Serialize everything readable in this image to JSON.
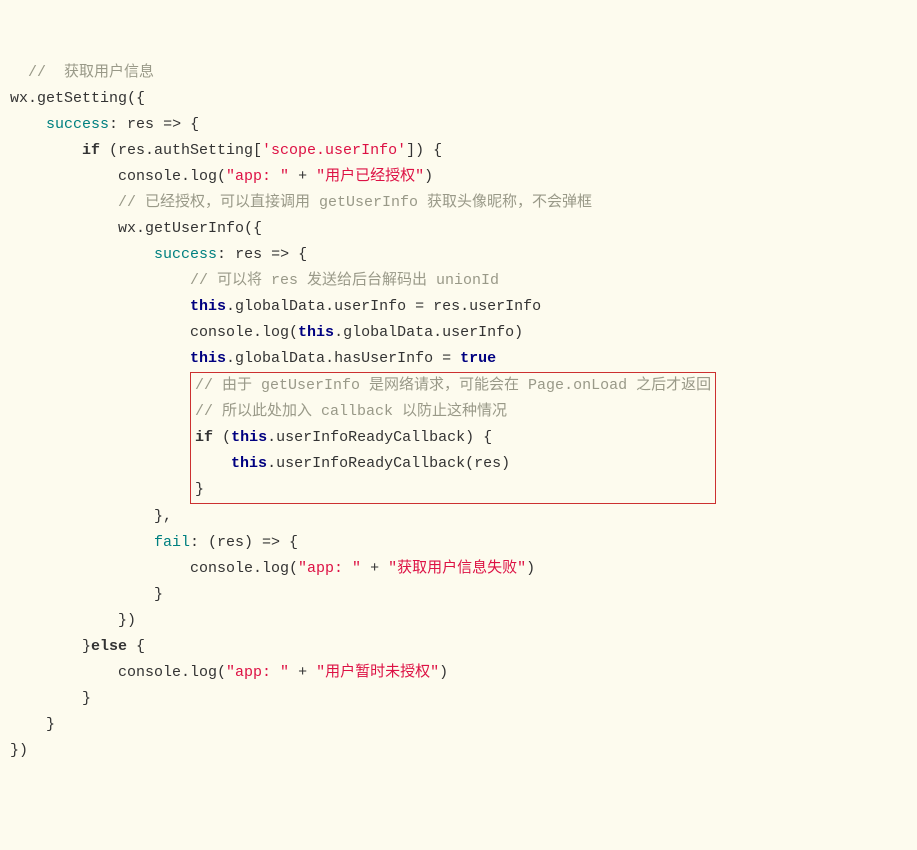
{
  "code": {
    "l01": "  //  获取用户信息",
    "l02a": "wx",
    "l02b": ".getSetting({",
    "l03a": "    success",
    "l03b": ": ",
    "l03c": "res",
    "l03d": " => {",
    "l04a": "        if",
    "l04b": " (res.authSetting[",
    "l04c": "'scope.userInfo'",
    "l04d": "]) {",
    "l05a": "            console.log(",
    "l05b": "\"app: \"",
    "l05c": " + ",
    "l05d": "\"用户已经授权\"",
    "l05e": ")",
    "l06": "            // 已经授权，可以直接调用 getUserInfo 获取头像昵称，不会弹框",
    "l07a": "            wx",
    "l07b": ".getUserInfo({",
    "l08a": "                success",
    "l08b": ": ",
    "l08c": "res",
    "l08d": " => {",
    "l09": "                    // 可以将 res 发送给后台解码出 unionId",
    "l10a": "                    ",
    "l10b": "this",
    "l10c": ".globalData.userInfo = res.userInfo",
    "l11a": "                    console.log(",
    "l11b": "this",
    "l11c": ".globalData.userInfo)",
    "l12a": "                    ",
    "l12b": "this",
    "l12c": ".globalData.hasUserInfo = ",
    "l12d": "true",
    "pad": "                    ",
    "h01": "// 由于 getUserInfo 是网络请求，可能会在 Page.onLoad 之后才返回",
    "h02": "// 所以此处加入 callback 以防止这种情况",
    "h03a": "if",
    "h03b": " (",
    "h03c": "this",
    "h03d": ".userInfoReadyCallback) {",
    "h04a": "    ",
    "h04b": "this",
    "h04c": ".userInfoReadyCallback(res)",
    "h05": "}",
    "l18": "                },",
    "l19a": "                fail",
    "l19b": ": (res) => {",
    "l20a": "                    console.log(",
    "l20b": "\"app: \"",
    "l20c": " + ",
    "l20d": "\"获取用户信息失败\"",
    "l20e": ")",
    "l21": "                }",
    "l22": "            })",
    "l23a": "        }",
    "l23b": "else",
    "l23c": " {",
    "l24a": "            console.log(",
    "l24b": "\"app: \"",
    "l24c": " + ",
    "l24d": "\"用户暂时未授权\"",
    "l24e": ")",
    "l25": "        }",
    "l26": "    }",
    "l27": "})"
  }
}
